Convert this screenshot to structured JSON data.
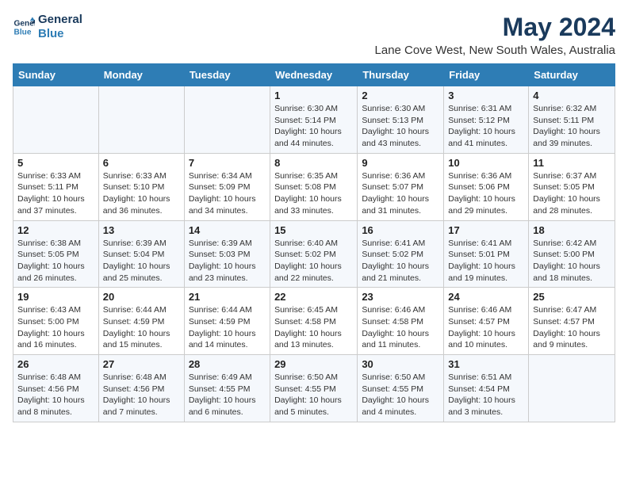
{
  "logo": {
    "line1": "General",
    "line2": "Blue"
  },
  "title": "May 2024",
  "subtitle": "Lane Cove West, New South Wales, Australia",
  "weekdays": [
    "Sunday",
    "Monday",
    "Tuesday",
    "Wednesday",
    "Thursday",
    "Friday",
    "Saturday"
  ],
  "weeks": [
    [
      {
        "day": "",
        "info": ""
      },
      {
        "day": "",
        "info": ""
      },
      {
        "day": "",
        "info": ""
      },
      {
        "day": "1",
        "info": "Sunrise: 6:30 AM\nSunset: 5:14 PM\nDaylight: 10 hours\nand 44 minutes."
      },
      {
        "day": "2",
        "info": "Sunrise: 6:30 AM\nSunset: 5:13 PM\nDaylight: 10 hours\nand 43 minutes."
      },
      {
        "day": "3",
        "info": "Sunrise: 6:31 AM\nSunset: 5:12 PM\nDaylight: 10 hours\nand 41 minutes."
      },
      {
        "day": "4",
        "info": "Sunrise: 6:32 AM\nSunset: 5:11 PM\nDaylight: 10 hours\nand 39 minutes."
      }
    ],
    [
      {
        "day": "5",
        "info": "Sunrise: 6:33 AM\nSunset: 5:11 PM\nDaylight: 10 hours\nand 37 minutes."
      },
      {
        "day": "6",
        "info": "Sunrise: 6:33 AM\nSunset: 5:10 PM\nDaylight: 10 hours\nand 36 minutes."
      },
      {
        "day": "7",
        "info": "Sunrise: 6:34 AM\nSunset: 5:09 PM\nDaylight: 10 hours\nand 34 minutes."
      },
      {
        "day": "8",
        "info": "Sunrise: 6:35 AM\nSunset: 5:08 PM\nDaylight: 10 hours\nand 33 minutes."
      },
      {
        "day": "9",
        "info": "Sunrise: 6:36 AM\nSunset: 5:07 PM\nDaylight: 10 hours\nand 31 minutes."
      },
      {
        "day": "10",
        "info": "Sunrise: 6:36 AM\nSunset: 5:06 PM\nDaylight: 10 hours\nand 29 minutes."
      },
      {
        "day": "11",
        "info": "Sunrise: 6:37 AM\nSunset: 5:05 PM\nDaylight: 10 hours\nand 28 minutes."
      }
    ],
    [
      {
        "day": "12",
        "info": "Sunrise: 6:38 AM\nSunset: 5:05 PM\nDaylight: 10 hours\nand 26 minutes."
      },
      {
        "day": "13",
        "info": "Sunrise: 6:39 AM\nSunset: 5:04 PM\nDaylight: 10 hours\nand 25 minutes."
      },
      {
        "day": "14",
        "info": "Sunrise: 6:39 AM\nSunset: 5:03 PM\nDaylight: 10 hours\nand 23 minutes."
      },
      {
        "day": "15",
        "info": "Sunrise: 6:40 AM\nSunset: 5:02 PM\nDaylight: 10 hours\nand 22 minutes."
      },
      {
        "day": "16",
        "info": "Sunrise: 6:41 AM\nSunset: 5:02 PM\nDaylight: 10 hours\nand 21 minutes."
      },
      {
        "day": "17",
        "info": "Sunrise: 6:41 AM\nSunset: 5:01 PM\nDaylight: 10 hours\nand 19 minutes."
      },
      {
        "day": "18",
        "info": "Sunrise: 6:42 AM\nSunset: 5:00 PM\nDaylight: 10 hours\nand 18 minutes."
      }
    ],
    [
      {
        "day": "19",
        "info": "Sunrise: 6:43 AM\nSunset: 5:00 PM\nDaylight: 10 hours\nand 16 minutes."
      },
      {
        "day": "20",
        "info": "Sunrise: 6:44 AM\nSunset: 4:59 PM\nDaylight: 10 hours\nand 15 minutes."
      },
      {
        "day": "21",
        "info": "Sunrise: 6:44 AM\nSunset: 4:59 PM\nDaylight: 10 hours\nand 14 minutes."
      },
      {
        "day": "22",
        "info": "Sunrise: 6:45 AM\nSunset: 4:58 PM\nDaylight: 10 hours\nand 13 minutes."
      },
      {
        "day": "23",
        "info": "Sunrise: 6:46 AM\nSunset: 4:58 PM\nDaylight: 10 hours\nand 11 minutes."
      },
      {
        "day": "24",
        "info": "Sunrise: 6:46 AM\nSunset: 4:57 PM\nDaylight: 10 hours\nand 10 minutes."
      },
      {
        "day": "25",
        "info": "Sunrise: 6:47 AM\nSunset: 4:57 PM\nDaylight: 10 hours\nand 9 minutes."
      }
    ],
    [
      {
        "day": "26",
        "info": "Sunrise: 6:48 AM\nSunset: 4:56 PM\nDaylight: 10 hours\nand 8 minutes."
      },
      {
        "day": "27",
        "info": "Sunrise: 6:48 AM\nSunset: 4:56 PM\nDaylight: 10 hours\nand 7 minutes."
      },
      {
        "day": "28",
        "info": "Sunrise: 6:49 AM\nSunset: 4:55 PM\nDaylight: 10 hours\nand 6 minutes."
      },
      {
        "day": "29",
        "info": "Sunrise: 6:50 AM\nSunset: 4:55 PM\nDaylight: 10 hours\nand 5 minutes."
      },
      {
        "day": "30",
        "info": "Sunrise: 6:50 AM\nSunset: 4:55 PM\nDaylight: 10 hours\nand 4 minutes."
      },
      {
        "day": "31",
        "info": "Sunrise: 6:51 AM\nSunset: 4:54 PM\nDaylight: 10 hours\nand 3 minutes."
      },
      {
        "day": "",
        "info": ""
      }
    ]
  ]
}
